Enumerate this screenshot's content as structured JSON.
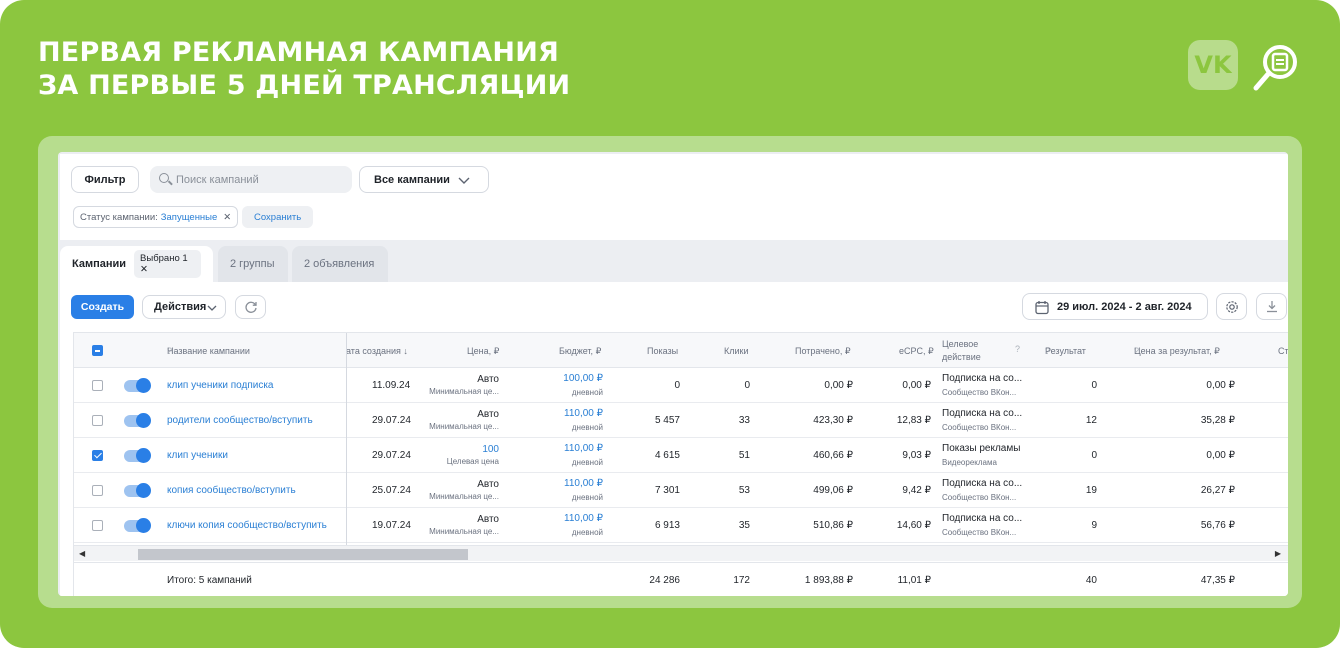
{
  "headline": {
    "line1": "ПЕРВАЯ РЕКЛАМНАЯ КАМПАНИЯ",
    "line2": "ЗА ПЕРВЫЕ 5 ДНЕЙ ТРАНСЛЯЦИИ"
  },
  "logos": {
    "vk": "VK",
    "search_icon": "search-badge-icon"
  },
  "toolbar": {
    "filter_label": "Фильтр",
    "search_placeholder": "Поиск кампаний",
    "campaigns_select": "Все кампании",
    "status_chip_label": "Статус кампании:",
    "status_chip_value": "Запущенные",
    "status_chip_close": "✕",
    "save_label": "Сохранить"
  },
  "tabs": {
    "campaigns": "Кампании",
    "selected": "Выбрано 1",
    "groups": "2 группы",
    "ads": "2 объявления"
  },
  "actions": {
    "create": "Создать",
    "actions_label": "Действия",
    "date_range": "29 июл. 2024 - 2 авг. 2024"
  },
  "table": {
    "headers": {
      "name": "Название кампании",
      "created": "ата создания ↓",
      "price": "Цена, ₽",
      "budget": "Бюджет, ₽",
      "impressions": "Показы",
      "clicks": "Клики",
      "spent": "Потрачено, ₽",
      "ecpc": "eCPC, ₽",
      "target_1": "Целевое",
      "target_2": "действие",
      "result": "Результат",
      "cpr": "Цена за результат, ₽",
      "cut": "Ст"
    },
    "rows": [
      {
        "name": "клип ученики подписка",
        "created": "11.09.24",
        "price": "Авто",
        "price_sub": "Минимальная це...",
        "budget": "100,00 ₽",
        "budget_sub": "дневной",
        "impressions": "0",
        "clicks": "0",
        "spent": "0,00 ₽",
        "ecpc": "0,00 ₽",
        "target": "Подписка на со...",
        "target_sub": "Сообщество ВКон...",
        "result": "0",
        "cpr": "0,00 ₽",
        "checked": false
      },
      {
        "name": "родители сообщество/вступить",
        "created": "29.07.24",
        "price": "Авто",
        "price_sub": "Минимальная це...",
        "budget": "110,00 ₽",
        "budget_sub": "дневной",
        "impressions": "5 457",
        "clicks": "33",
        "spent": "423,30 ₽",
        "ecpc": "12,83 ₽",
        "target": "Подписка на со...",
        "target_sub": "Сообщество ВКон...",
        "result": "12",
        "cpr": "35,28 ₽",
        "checked": false
      },
      {
        "name": "клип ученики",
        "created": "29.07.24",
        "price": "100",
        "price_sub": "Целевая цена",
        "budget": "110,00 ₽",
        "budget_sub": "дневной",
        "impressions": "4 615",
        "clicks": "51",
        "spent": "460,66 ₽",
        "ecpc": "9,03 ₽",
        "target": "Показы рекламы",
        "target_sub": "Видеореклама",
        "result": "0",
        "cpr": "0,00 ₽",
        "checked": true
      },
      {
        "name": "копия сообщество/вступить",
        "created": "25.07.24",
        "price": "Авто",
        "price_sub": "Минимальная це...",
        "budget": "110,00 ₽",
        "budget_sub": "дневной",
        "impressions": "7 301",
        "clicks": "53",
        "spent": "499,06 ₽",
        "ecpc": "9,42 ₽",
        "target": "Подписка на со...",
        "target_sub": "Сообщество ВКон...",
        "result": "19",
        "cpr": "26,27 ₽",
        "checked": false
      },
      {
        "name": "ключи копия сообщество/вступить",
        "created": "19.07.24",
        "price": "Авто",
        "price_sub": "Минимальная це...",
        "budget": "110,00 ₽",
        "budget_sub": "дневной",
        "impressions": "6 913",
        "clicks": "35",
        "spent": "510,86 ₽",
        "ecpc": "14,60 ₽",
        "target": "Подписка на со...",
        "target_sub": "Сообщество ВКон...",
        "result": "9",
        "cpr": "56,76 ₽",
        "checked": false
      }
    ],
    "totals": {
      "label": "Итого: 5 кампаний",
      "impressions": "24 286",
      "clicks": "172",
      "spent": "1 893,88 ₽",
      "ecpc": "11,01 ₽",
      "result": "40",
      "cpr": "47,35 ₽"
    }
  },
  "colors": {
    "brand_green": "#8cc63f",
    "accent_blue": "#2a7fe6"
  }
}
